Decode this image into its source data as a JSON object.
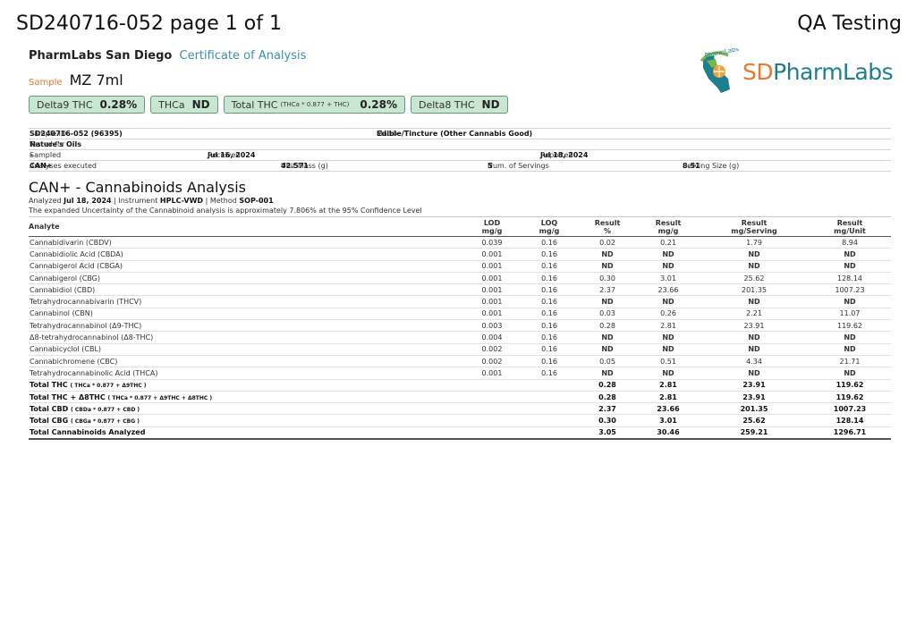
{
  "header": {
    "title": "SD240716-052 page 1 of 1",
    "right": "QA Testing",
    "lab_name": "PharmLabs San Diego",
    "coa": "Certificate of Analysis",
    "sample_label": "Sample",
    "sample_name": "MZ 7ml"
  },
  "logo": {
    "sd": "SD",
    "pharmlabs": "PharmLabs",
    "arc": "PharmLabs"
  },
  "badges": [
    {
      "label": "Delta9 THC",
      "small": "",
      "value": "0.28%"
    },
    {
      "label": "THCa",
      "small": "",
      "value": "ND"
    },
    {
      "label": "Total THC",
      "small": "(THCa * 0.877 + THC)",
      "value": "0.28%"
    },
    {
      "label": "Delta8 THC",
      "small": "",
      "value": "ND"
    }
  ],
  "meta": {
    "sample_id_label": "Sample ID",
    "sample_id": "SD240716-052 (96395)",
    "matrix_label": "Matrix",
    "matrix": "Edible/Tincture (Other Cannabis Good)",
    "tested_for_label": "Tested for",
    "tested_for": "Nature's Oils",
    "sampled_label": "Sampled",
    "sampled": "-",
    "received_label": "Received",
    "received": "Jul 16, 2024",
    "reported_label": "Reported",
    "reported": "Jul 18, 2024",
    "analyses_label": "Analyses executed",
    "analyses": "CAN+",
    "unit_mass_label": "Unit Mass (g)",
    "unit_mass": "42.571",
    "servings_label": "Num. of Servings",
    "servings": "5",
    "serving_size_label": "Serving Size (g)",
    "serving_size": "8.51"
  },
  "analysis": {
    "title": "CAN+ - Cannabinoids Analysis",
    "analyzed_label": "Analyzed",
    "analyzed": "Jul 18, 2024",
    "instrument_label": "Instrument",
    "instrument": "HPLC-VWD",
    "method_label": "Method",
    "method": "SOP-001",
    "uncertainty": "The expanded Uncertainty of the Cannabinoid analysis is approximately 7.806% at the 95% Confidence Level"
  },
  "table": {
    "headers": {
      "analyte": "Analyte",
      "lod": [
        "LOD",
        "mg/g"
      ],
      "loq": [
        "LOQ",
        "mg/g"
      ],
      "pct": [
        "Result",
        "%"
      ],
      "mgg": [
        "Result",
        "mg/g"
      ],
      "serv": [
        "Result",
        "mg/Serving"
      ],
      "unit": [
        "Result",
        "mg/Unit"
      ]
    },
    "rows": [
      [
        "Cannabidivarin (CBDV)",
        "0.039",
        "0.16",
        "0.02",
        "0.21",
        "1.79",
        "8.94"
      ],
      [
        "Cannabidiolic Acid (CBDA)",
        "0.001",
        "0.16",
        "ND",
        "ND",
        "ND",
        "ND"
      ],
      [
        "Cannabigerol Acid (CBGA)",
        "0.001",
        "0.16",
        "ND",
        "ND",
        "ND",
        "ND"
      ],
      [
        "Cannabigerol (CBG)",
        "0.001",
        "0.16",
        "0.30",
        "3.01",
        "25.62",
        "128.14"
      ],
      [
        "Cannabidiol (CBD)",
        "0.001",
        "0.16",
        "2.37",
        "23.66",
        "201.35",
        "1007.23"
      ],
      [
        "Tetrahydrocannabivarin (THCV)",
        "0.001",
        "0.16",
        "ND",
        "ND",
        "ND",
        "ND"
      ],
      [
        "Cannabinol (CBN)",
        "0.001",
        "0.16",
        "0.03",
        "0.26",
        "2.21",
        "11.07"
      ],
      [
        "Tetrahydrocannabinol (Δ9-THC)",
        "0.003",
        "0.16",
        "0.28",
        "2.81",
        "23.91",
        "119.62"
      ],
      [
        "Δ8-tetrahydrocannabinol (Δ8-THC)",
        "0.004",
        "0.16",
        "ND",
        "ND",
        "ND",
        "ND"
      ],
      [
        "Cannabicyclol (CBL)",
        "0.002",
        "0.16",
        "ND",
        "ND",
        "ND",
        "ND"
      ],
      [
        "Cannabichromene (CBC)",
        "0.002",
        "0.16",
        "0.05",
        "0.51",
        "4.34",
        "21.71"
      ],
      [
        "Tetrahydrocannabinolic Acid (THCA)",
        "0.001",
        "0.16",
        "ND",
        "ND",
        "ND",
        "ND"
      ]
    ],
    "totals": [
      [
        "Total THC",
        "( THCa * 0.877 + Δ9THC )",
        "0.28",
        "2.81",
        "23.91",
        "119.62"
      ],
      [
        "Total THC + Δ8THC",
        "( THCa * 0.877 + Δ9THC + Δ8THC )",
        "0.28",
        "2.81",
        "23.91",
        "119.62"
      ],
      [
        "Total CBD",
        "( CBDa * 0.877 + CBD )",
        "2.37",
        "23.66",
        "201.35",
        "1007.23"
      ],
      [
        "Total CBG",
        "( CBGa * 0.877 + CBG )",
        "0.30",
        "3.01",
        "25.62",
        "128.14"
      ],
      [
        "Total Cannabinoids Analyzed",
        "",
        "3.05",
        "30.46",
        "259.21",
        "1296.71"
      ]
    ]
  }
}
